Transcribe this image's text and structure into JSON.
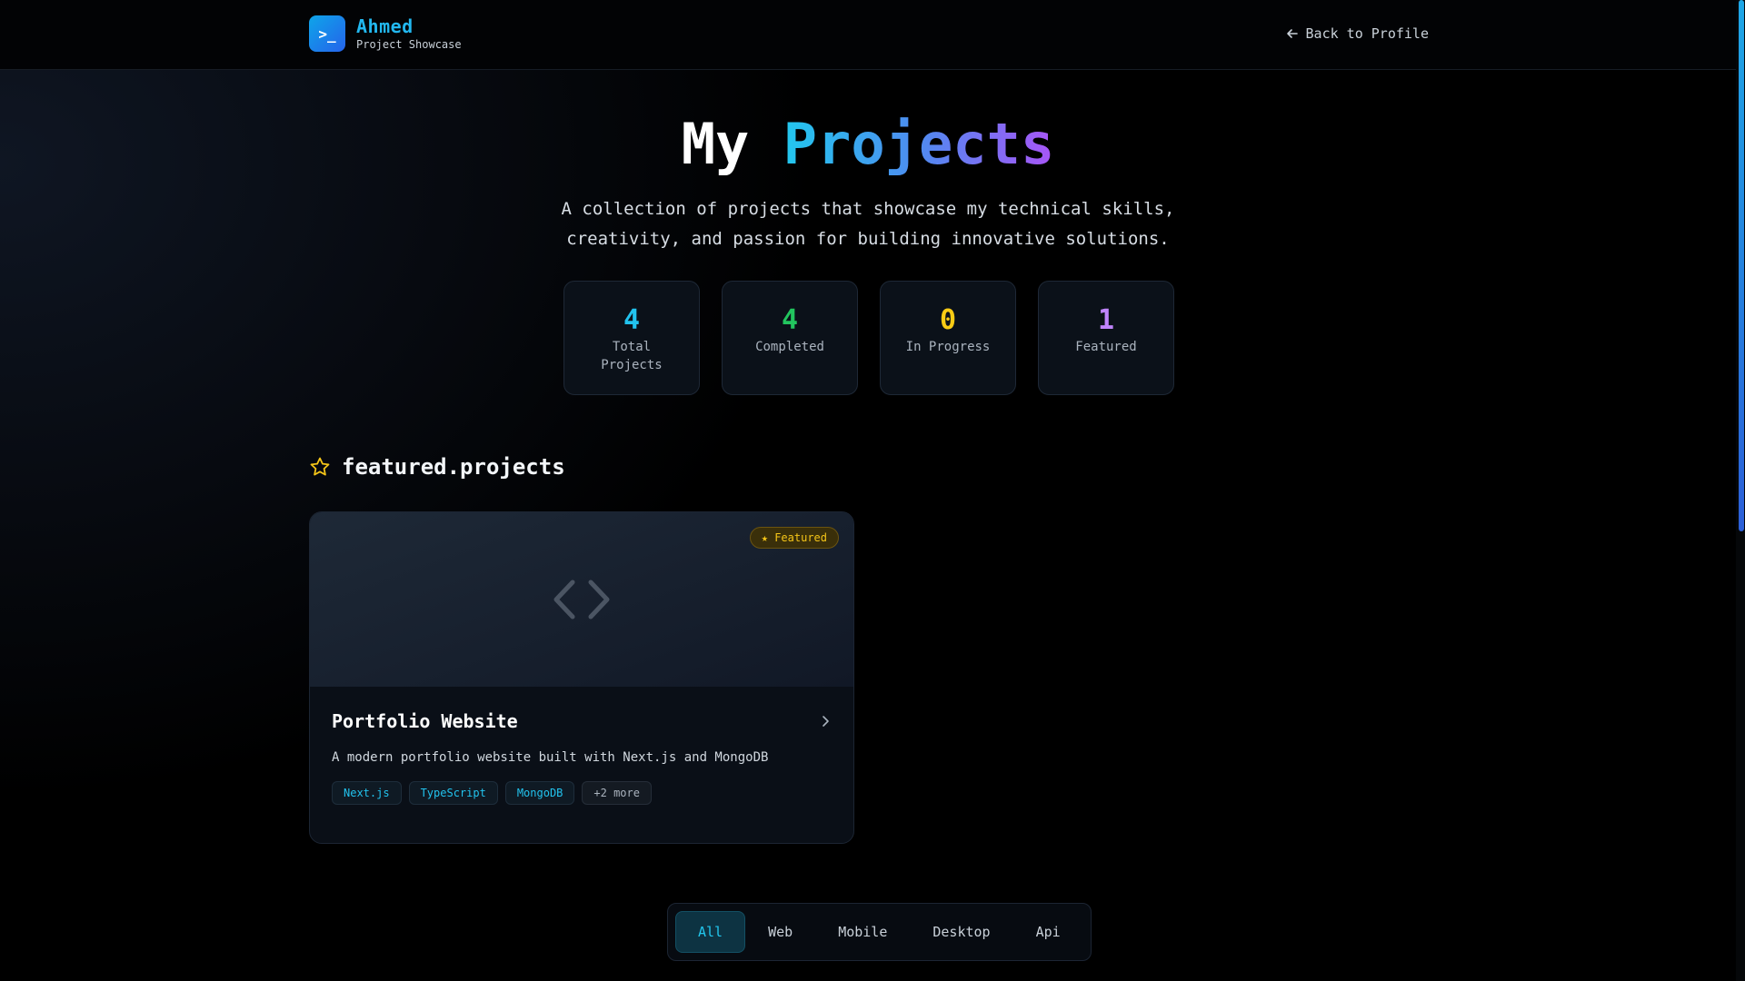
{
  "header": {
    "brand_name": "Ahmed",
    "brand_sub": "Project Showcase",
    "logo_glyph": ">_",
    "back_label": "Back to Profile"
  },
  "hero": {
    "title_plain": "My",
    "title_accent": "Projects",
    "description": "A collection of projects that showcase my technical skills, creativity, and passion for building innovative solutions."
  },
  "stats": [
    {
      "value": "4",
      "label": "Total Projects",
      "color": "#22c3ee"
    },
    {
      "value": "4",
      "label": "Completed",
      "color": "#22c55e"
    },
    {
      "value": "0",
      "label": "In Progress",
      "color": "#facc15"
    },
    {
      "value": "1",
      "label": "Featured",
      "color": "#c084fc"
    }
  ],
  "featured": {
    "section_title": "featured.projects",
    "card": {
      "badge": "★ Featured",
      "title": "Portfolio Website",
      "description": "A modern portfolio website built with Next.js and MongoDB",
      "tags": [
        "Next.js",
        "TypeScript",
        "MongoDB"
      ],
      "more": "+2 more"
    }
  },
  "filters": {
    "items": [
      "All",
      "Web",
      "Mobile",
      "Desktop",
      "Api"
    ],
    "active": "All"
  },
  "colors": {
    "accent": "#22c7ee",
    "featured": "#f5c518"
  }
}
